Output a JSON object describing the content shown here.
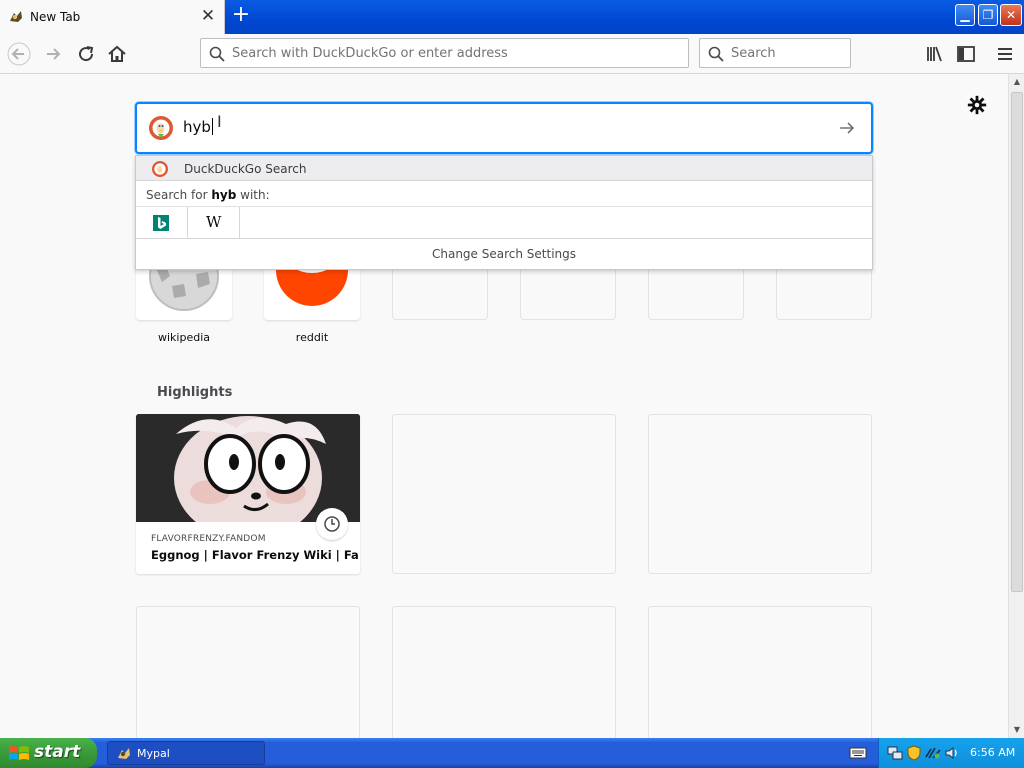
{
  "browser": {
    "tab_title": "New Tab",
    "urlbar_placeholder": "Search with DuckDuckGo or enter address",
    "searchbar_placeholder": "Search"
  },
  "newtab": {
    "search_query": "hyb",
    "suggestions": {
      "default_engine_label": "DuckDuckGo Search",
      "search_for_prefix": "Search for ",
      "search_for_term": "hyb",
      "search_for_suffix": " with:",
      "engines": [
        "bing-icon",
        "wikipedia-icon"
      ],
      "wiki_glyph": "W",
      "settings_label": "Change Search Settings"
    },
    "top_sites": [
      {
        "label": "wikipedia"
      },
      {
        "label": "reddit"
      }
    ],
    "highlights_title": "Highlights",
    "highlight_card": {
      "host": "FLAVORFRENZY.FANDOM",
      "title": "Eggnog | Flavor Frenzy Wiki | Fa..."
    }
  },
  "taskbar": {
    "start_label": "start",
    "task_label": "Mypal",
    "clock": "6:56 AM"
  },
  "colors": {
    "accent": "#0a84ff",
    "reddit": "#ff4500",
    "xp_blue": "#245edb",
    "start_green": "#3a9a3b"
  }
}
